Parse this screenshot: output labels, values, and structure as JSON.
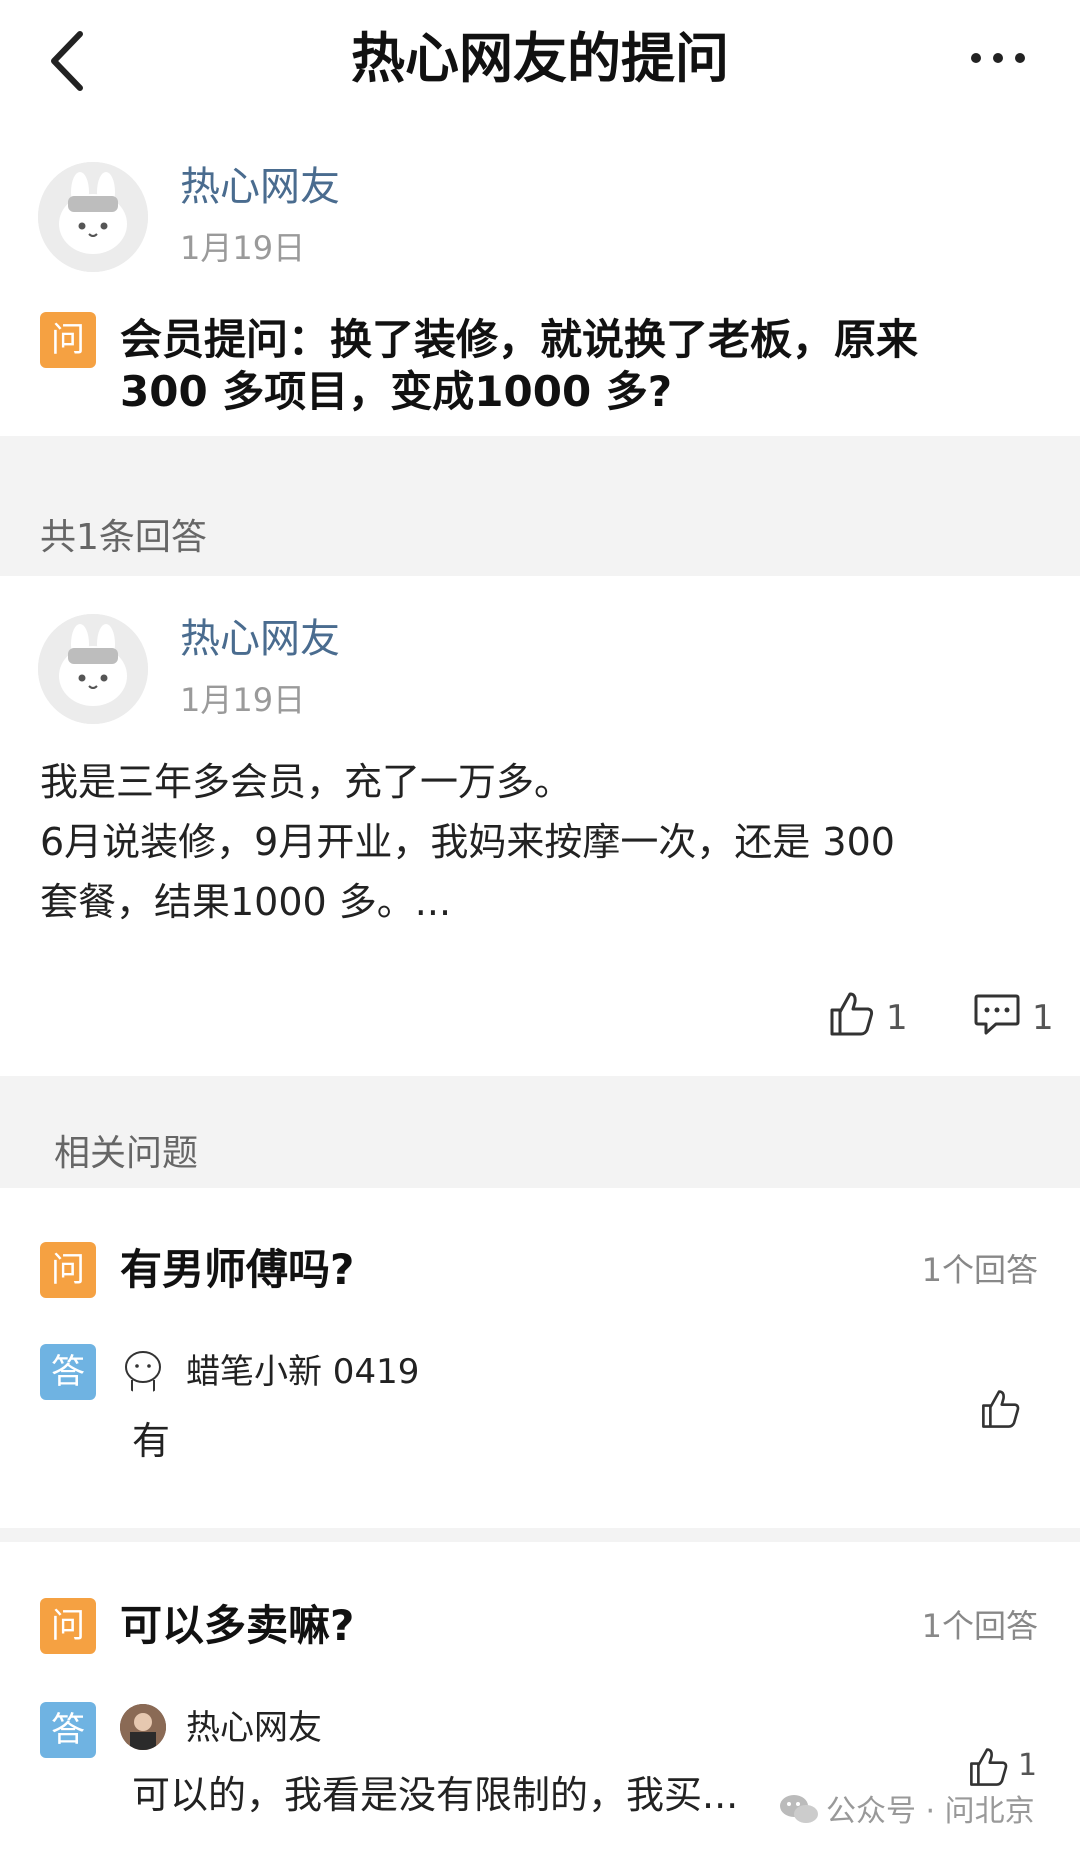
{
  "header": {
    "title": "热心网友的提问"
  },
  "question": {
    "user": "热心网友",
    "date": "1月19日",
    "badge": "问",
    "title_line1": "会员提问：换了装修，就说换了老板，原来",
    "title_line2": "300 多项目，变成1000 多?"
  },
  "answers_section": {
    "label": "共1条回答"
  },
  "answer": {
    "user": "热心网友",
    "date": "1月19日",
    "lines": [
      "我是三年多会员，充了一万多。",
      "6月说装修，9月开业，我妈来按摩一次，还是 300",
      "套餐，结果1000 多。..."
    ],
    "likes": "1",
    "comments": "1"
  },
  "related": {
    "label": "相关问题",
    "items": [
      {
        "q_badge": "问",
        "title": "有男师傅吗?",
        "answers": "1个回答",
        "a_badge": "答",
        "user": "蜡笔小新 0419",
        "text": "有",
        "likes": ""
      },
      {
        "q_badge": "问",
        "title": "可以多卖嘛?",
        "answers": "1个回答",
        "a_badge": "答",
        "user": "热心网友",
        "text": "可以的，我看是没有限制的，我买...",
        "likes": "1"
      }
    ]
  },
  "watermark": "公众号 · 问北京",
  "colors": {
    "username": "#4a6c8f",
    "question_badge": "#f5a142",
    "answer_badge": "#6fb3e2",
    "band": "#f3f3f3"
  }
}
